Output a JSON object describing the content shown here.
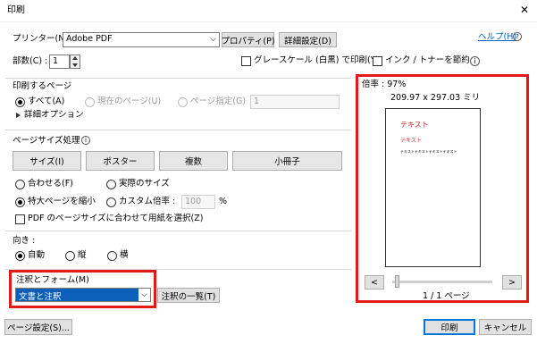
{
  "window": {
    "title": "印刷",
    "close_glyph": "✕"
  },
  "top": {
    "printer_label": "プリンター(N) :",
    "printer_value": "Adobe PDF",
    "properties_btn": "プロパティ(P)",
    "advanced_btn": "詳細設定(D)",
    "help_link": "ヘルプ(H)",
    "copies_label": "部数(C) :",
    "copies_value": "1",
    "grayscale_label": "グレースケール (白黒) で印刷(Y)",
    "saveink_label": "インク / トナーを節約",
    "info_glyph": "i"
  },
  "pages": {
    "title": "印刷するページ",
    "all": "すべて(A)",
    "current": "現在のページ(U)",
    "specify": "ページ指定(G)",
    "range_value": "1",
    "more_options": "詳細オプション"
  },
  "sizing": {
    "title": "ページサイズ処理",
    "buttons": [
      "サイズ(I)",
      "ポスター",
      "複数",
      "小冊子"
    ],
    "fit": "合わせる(F)",
    "actual": "実際のサイズ",
    "shrink": "特大ページを縮小",
    "custom": "カスタム倍率 :",
    "custom_value": "100",
    "percent": "%",
    "pdf_paper": "PDF のページサイズに合わせて用紙を選択(Z)"
  },
  "orientation": {
    "title": "向き :",
    "auto": "自動",
    "portrait": "縦",
    "landscape": "横"
  },
  "comments": {
    "title": "注釈とフォーム(M)",
    "value": "文書と注釈",
    "summary_btn": "注釈の一覧(T)"
  },
  "preview": {
    "zoom": "倍率 : 97%",
    "dimensions": "209.97 x 297.03 ミリ",
    "paper_title": "テキスト",
    "paper_sub": "テキスト",
    "paper_line": "テキストテキストテキストテキスト",
    "page_count": "1 / 1 ページ",
    "prev_glyph": "<",
    "next_glyph": ">"
  },
  "bottom": {
    "page_setup": "ページ設定(S)...",
    "print": "印刷",
    "cancel": "キャンセル"
  },
  "colors": {
    "highlight": "#e11919",
    "accent": "#0078d7",
    "paper_red": "#d42a2a"
  }
}
